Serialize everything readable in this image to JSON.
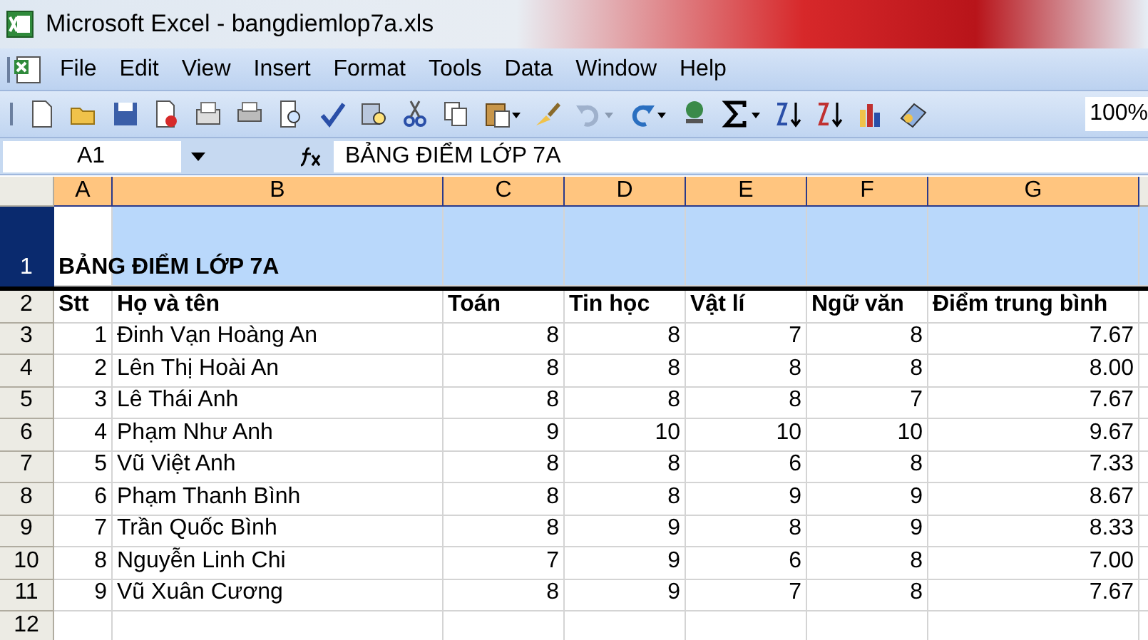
{
  "window": {
    "title": "Microsoft Excel - bangdiemlop7a.xls"
  },
  "menu": [
    "File",
    "Edit",
    "View",
    "Insert",
    "Format",
    "Tools",
    "Data",
    "Window",
    "Help"
  ],
  "toolbar": {
    "zoom": "100%"
  },
  "formula_bar": {
    "name_box": "A1",
    "value": "BẢNG ĐIỂM LỚP 7A"
  },
  "sheet": {
    "columns": [
      {
        "label": "A",
        "selected": true
      },
      {
        "label": "B",
        "selected": true
      },
      {
        "label": "C",
        "selected": true
      },
      {
        "label": "D",
        "selected": true
      },
      {
        "label": "E",
        "selected": true
      },
      {
        "label": "F",
        "selected": true
      },
      {
        "label": "G",
        "selected": true
      }
    ],
    "rows": [
      {
        "header": "1",
        "kind": "title",
        "selected": true,
        "cells": [
          "BẢNG ĐIỂM LỚP 7A"
        ]
      },
      {
        "header": "2",
        "kind": "header",
        "selected": false,
        "cells": [
          "Stt",
          "Họ và tên",
          "Toán",
          "Tin học",
          "Vật lí",
          "Ngữ văn",
          "Điểm trung bình"
        ]
      },
      {
        "header": "3",
        "kind": "data",
        "selected": false,
        "cells": [
          "1",
          "Đinh Vạn Hoàng An",
          "8",
          "8",
          "7",
          "8",
          "7.67"
        ]
      },
      {
        "header": "4",
        "kind": "data",
        "selected": false,
        "cells": [
          "2",
          "Lên Thị Hoài An",
          "8",
          "8",
          "8",
          "8",
          "8.00"
        ]
      },
      {
        "header": "5",
        "kind": "data",
        "selected": false,
        "cells": [
          "3",
          "Lê Thái Anh",
          "8",
          "8",
          "8",
          "7",
          "7.67"
        ]
      },
      {
        "header": "6",
        "kind": "data",
        "selected": false,
        "cells": [
          "4",
          "Phạm Như Anh",
          "9",
          "10",
          "10",
          "10",
          "9.67"
        ]
      },
      {
        "header": "7",
        "kind": "data",
        "selected": false,
        "cells": [
          "5",
          "Vũ Việt Anh",
          "8",
          "8",
          "6",
          "8",
          "7.33"
        ]
      },
      {
        "header": "8",
        "kind": "data",
        "selected": false,
        "cells": [
          "6",
          "Phạm Thanh Bình",
          "8",
          "8",
          "9",
          "9",
          "8.67"
        ]
      },
      {
        "header": "9",
        "kind": "data",
        "selected": false,
        "cells": [
          "7",
          "Trần Quốc Bình",
          "8",
          "9",
          "8",
          "9",
          "8.33"
        ]
      },
      {
        "header": "10",
        "kind": "data",
        "selected": false,
        "cells": [
          "8",
          "Nguyễn Linh Chi",
          "7",
          "9",
          "6",
          "8",
          "7.00"
        ]
      },
      {
        "header": "11",
        "kind": "data",
        "selected": false,
        "cells": [
          "9",
          "Vũ Xuân Cương",
          "8",
          "9",
          "7",
          "8",
          "7.67"
        ]
      },
      {
        "header": "12",
        "kind": "blank",
        "selected": false,
        "cells": []
      }
    ]
  }
}
